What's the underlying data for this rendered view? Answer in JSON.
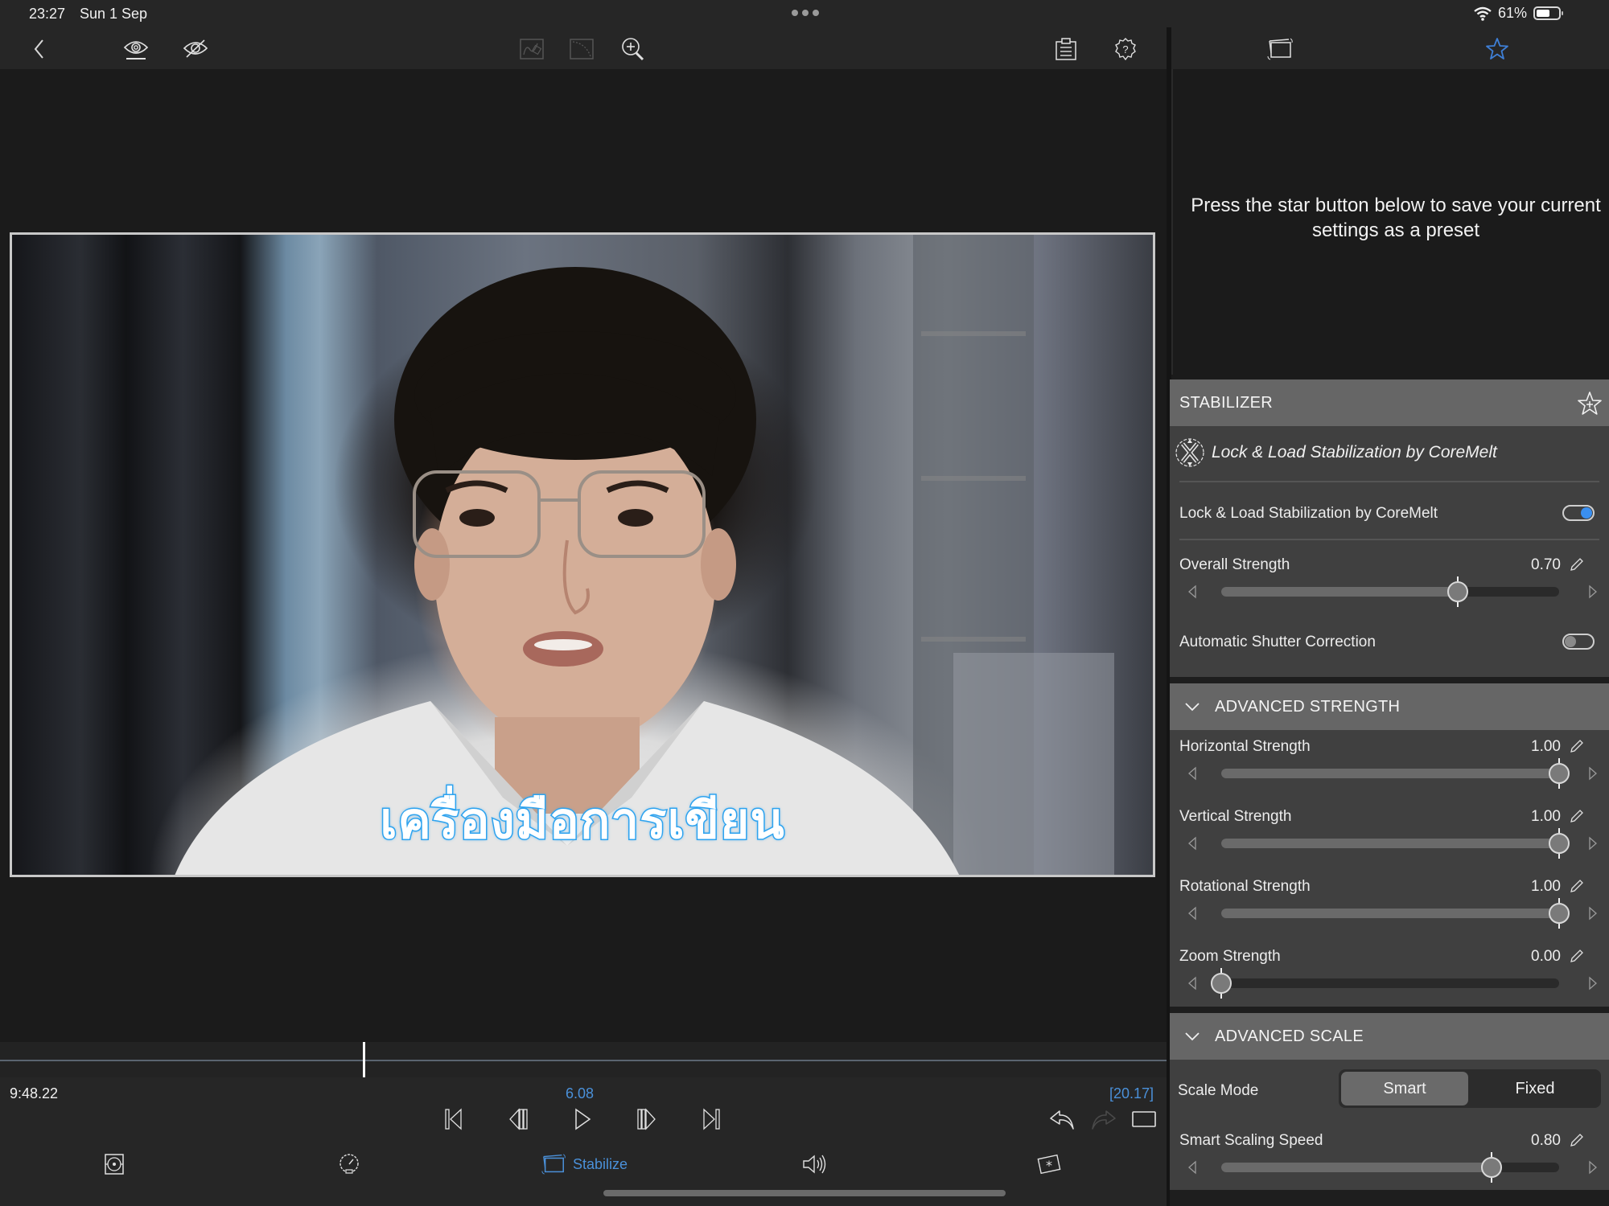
{
  "status_bar": {
    "time": "23:27",
    "date": "Sun 1 Sep",
    "battery_percent_label": "61%",
    "battery_level": 0.61
  },
  "toolbar": {
    "icons": {
      "back": "chevron-left-icon",
      "show_overlay": "eye-icon",
      "hide_overlay": "eye-slash-icon",
      "mask": "mask-tool-icon",
      "curve": "curve-tool-icon",
      "zoom": "zoom-in-icon",
      "notes": "clipboard-icon",
      "help_settings": "gear-question-icon"
    }
  },
  "right_toolbar": {
    "icons": {
      "stabilize": "stabilize-icon",
      "presets": "star-icon"
    },
    "accent_color": "#3e7fd6"
  },
  "viewer": {
    "subtitle": "เครื่องมือการเขียน",
    "subtitle_color": "#2ea3ef"
  },
  "timeline": {
    "playhead_fraction": 0.311
  },
  "transport": {
    "current_time": "9:48.22",
    "position": "6.08",
    "duration": "[20.17]",
    "accent_color": "#4a90d9",
    "buttons": [
      "skip-to-start",
      "step-back",
      "play",
      "step-forward",
      "skip-to-end"
    ],
    "undo": "undo-icon",
    "redo": "redo-icon",
    "fullscreen": "fullscreen-icon"
  },
  "bottom_tabs": [
    {
      "id": "transform",
      "icon": "transform-icon",
      "label": ""
    },
    {
      "id": "speed",
      "icon": "speedometer-icon",
      "label": ""
    },
    {
      "id": "stabilize",
      "icon": "stabilize-icon",
      "label": "Stabilize",
      "active": true
    },
    {
      "id": "audio",
      "icon": "speaker-icon",
      "label": ""
    },
    {
      "id": "effects",
      "icon": "effects-icon",
      "label": ""
    }
  ],
  "presets": {
    "hint": "Press the star button below to save your current settings as a preset"
  },
  "inspector": {
    "stabilizer": {
      "title": "STABILIZER",
      "plugin_name": "Lock & Load Stabilization by CoreMelt",
      "enable_label": "Lock & Load Stabilization by CoreMelt",
      "enabled": true,
      "overall_strength": {
        "label": "Overall Strength",
        "value": "0.70",
        "fraction": 0.7
      },
      "shutter_correction": {
        "label": "Automatic Shutter Correction",
        "enabled": false
      }
    },
    "advanced_strength": {
      "title": "ADVANCED STRENGTH",
      "sliders": [
        {
          "label": "Horizontal Strength",
          "value": "1.00",
          "fraction": 1.0
        },
        {
          "label": "Vertical Strength",
          "value": "1.00",
          "fraction": 1.0
        },
        {
          "label": "Rotational Strength",
          "value": "1.00",
          "fraction": 1.0
        },
        {
          "label": "Zoom Strength",
          "value": "0.00",
          "fraction": 0.0
        }
      ]
    },
    "advanced_scale": {
      "title": "ADVANCED SCALE",
      "scale_mode": {
        "label": "Scale Mode",
        "options": [
          "Smart",
          "Fixed"
        ],
        "selected": "Smart"
      },
      "smart_scaling_speed": {
        "label": "Smart Scaling Speed",
        "value": "0.80",
        "fraction": 0.8
      }
    },
    "toggle_on_color": "#3a8ff0"
  }
}
